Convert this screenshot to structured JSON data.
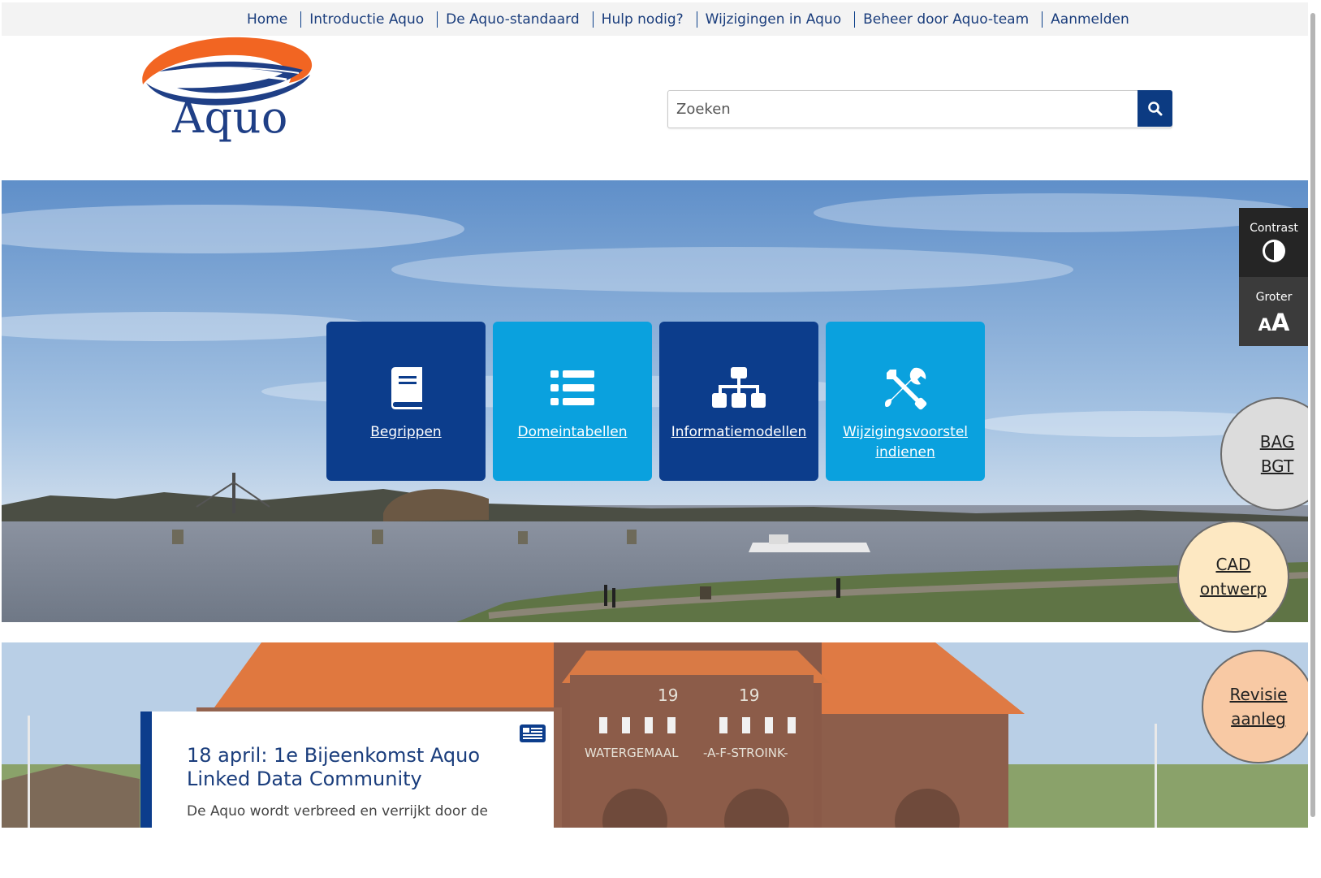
{
  "nav": {
    "items": [
      {
        "label": "Home"
      },
      {
        "label": "Introductie Aquo"
      },
      {
        "label": "De Aquo-standaard"
      },
      {
        "label": "Hulp nodig?"
      },
      {
        "label": "Wijzigingen in Aquo"
      },
      {
        "label": "Beheer door Aquo-team"
      },
      {
        "label": "Aanmelden"
      }
    ]
  },
  "header": {
    "logo_text": "Aquo",
    "search": {
      "placeholder": "Zoeken",
      "button_icon": "search-icon"
    }
  },
  "hero": {
    "tiles": [
      {
        "label": "Begrippen",
        "icon": "book-icon"
      },
      {
        "label": "Domeintabellen",
        "icon": "list-icon"
      },
      {
        "label": "Informatiemodellen",
        "icon": "sitemap-icon"
      },
      {
        "label": "Wijzigingsvoorstel indienen",
        "icon": "tools-icon"
      }
    ]
  },
  "accessibility": {
    "contrast_label": "Contrast",
    "bigger_label": "Groter",
    "bigger_glyph_small": "A",
    "bigger_glyph_big": "A"
  },
  "side_links": [
    {
      "label": "BAG\nBGT"
    },
    {
      "label": "CAD\nontwerp"
    },
    {
      "label": "Revisie\naanleg"
    }
  ],
  "news": {
    "title": "18 april: 1e Bijeenkomst Aquo Linked Data Community",
    "excerpt": "De Aquo wordt verbreed en verrijkt door de",
    "icon": "newspaper-icon"
  },
  "photo_text": {
    "year_left": "19",
    "year_right": "19",
    "sign_left": "WATERGEMAAL",
    "sign_right": "-A-F-STROINK-"
  },
  "colors": {
    "brand_dark": "#0c3d8c",
    "brand_light": "#0aa1de",
    "logo_orange": "#f26522"
  }
}
